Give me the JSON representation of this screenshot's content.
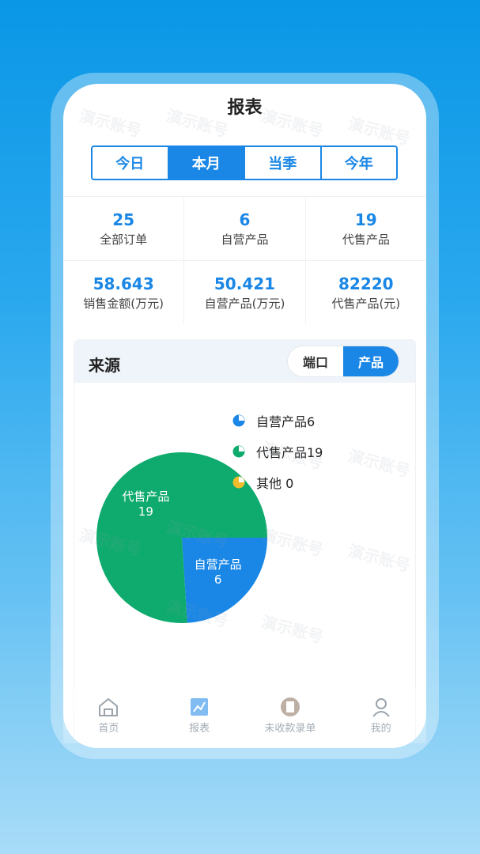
{
  "page": {
    "title": "报表"
  },
  "periods": [
    "今日",
    "本月",
    "当季",
    "今年"
  ],
  "active_period": "本月",
  "stats": [
    [
      {
        "value": "25",
        "label": "全部订单"
      },
      {
        "value": "6",
        "label": "自营产品"
      },
      {
        "value": "19",
        "label": "代售产品"
      }
    ],
    [
      {
        "value": "58.643",
        "label": "销售金额(万元)"
      },
      {
        "value": "50.421",
        "label": "自营产品(万元)"
      },
      {
        "value": "82220",
        "label": "代售产品(元)"
      }
    ]
  ],
  "source": {
    "title": "来源",
    "toggle": [
      "端口",
      "产品"
    ],
    "active_toggle": "产品"
  },
  "chart_data": {
    "type": "pie",
    "slices": [
      {
        "name": "自营产品",
        "value": 6,
        "color": "#1a87e6"
      },
      {
        "name": "代售产品",
        "value": 19,
        "color": "#0fab6e"
      },
      {
        "name": "其他",
        "value": 0,
        "color": "#f0bd2c"
      }
    ],
    "legend": [
      "自营产品6",
      "代售产品19",
      "其他 0"
    ],
    "legend_position": "right"
  },
  "watermark_text": "演示账号",
  "tabbar": [
    {
      "label": "首页",
      "icon": "home-icon"
    },
    {
      "label": "报表",
      "icon": "report-icon"
    },
    {
      "label": "未收款录单",
      "icon": "receipt-icon"
    },
    {
      "label": "我的",
      "icon": "user-icon"
    }
  ]
}
